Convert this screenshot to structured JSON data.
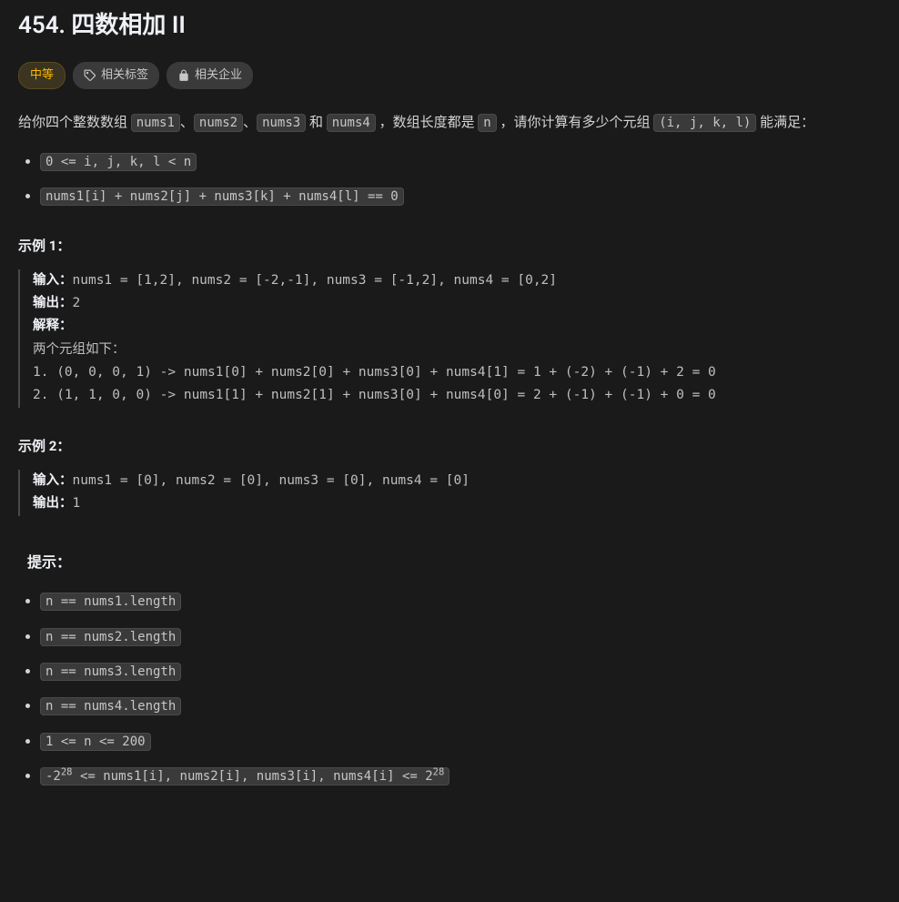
{
  "title": "454. 四数相加 II",
  "difficulty": "中等",
  "tag_topics": "相关标签",
  "tag_companies": "相关企业",
  "desc_part1": "给你四个整数数组 ",
  "desc_nums1": "nums1",
  "desc_sep1": "、",
  "desc_nums2": "nums2",
  "desc_sep2": "、",
  "desc_nums3": "nums3",
  "desc_part2": " 和 ",
  "desc_nums4": "nums4",
  "desc_part3": " ，数组长度都是 ",
  "desc_n": "n",
  "desc_part4": " ，请你计算有多少个元组 ",
  "desc_tuple": "(i, j, k, l)",
  "desc_part5": " 能满足：",
  "cond1": "0 <= i, j, k, l < n",
  "cond2": "nums1[i] + nums2[j] + nums3[k] + nums4[l] == 0",
  "example1_title": "示例 1：",
  "ex1_input_label": "输入：",
  "ex1_input": "nums1 = [1,2], nums2 = [-2,-1], nums3 = [-1,2], nums4 = [0,2]",
  "ex1_output_label": "输出：",
  "ex1_output": "2",
  "ex1_explain_label": "解释：",
  "ex1_explain_intro": "两个元组如下：",
  "ex1_line1": "1. (0, 0, 0, 1) -> nums1[0] + nums2[0] + nums3[0] + nums4[1] = 1 + (-2) + (-1) + 2 = 0",
  "ex1_line2": "2. (1, 1, 0, 0) -> nums1[1] + nums2[1] + nums3[0] + nums4[0] = 2 + (-1) + (-1) + 0 = 0",
  "example2_title": "示例 2：",
  "ex2_input_label": "输入：",
  "ex2_input": "nums1 = [0], nums2 = [0], nums3 = [0], nums4 = [0]",
  "ex2_output_label": "输出：",
  "ex2_output": "1",
  "hints_title": "提示：",
  "hint1": "n == nums1.length",
  "hint2": "n == nums2.length",
  "hint3": "n == nums3.length",
  "hint4": "n == nums4.length",
  "hint5": "1 <= n <= 200",
  "hint6_a": "-2",
  "hint6_exp1": "28",
  "hint6_b": " <= nums1[i], nums2[i], nums3[i], nums4[i] <= 2",
  "hint6_exp2": "28"
}
